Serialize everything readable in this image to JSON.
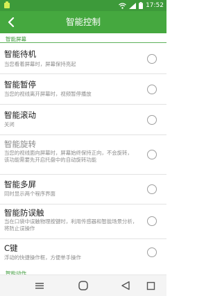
{
  "status_bar": {
    "time": "17:52",
    "icons": [
      "app-notification-icon",
      "wifi-icon",
      "signal-icon",
      "battery-icon"
    ]
  },
  "app_bar": {
    "title": "智能控制",
    "back_icon": "chevron-left-icon"
  },
  "section": {
    "header": "智能屏幕"
  },
  "items": [
    {
      "title": "智能待机",
      "description": "当您看着屏幕时，屏幕保持亮起",
      "enabled": true,
      "checked": false
    },
    {
      "title": "智能暂停",
      "description": "当您的视线离开屏幕时，视频暂停播放",
      "enabled": true,
      "checked": false
    },
    {
      "title": "智能滚动",
      "description": "关闭",
      "enabled": true,
      "checked": false
    },
    {
      "title": "智能旋转",
      "description": "当您的视线面向屏幕时，屏幕始终保持正向，不会旋转，该功能需要先开启托盘中的自动旋转功能",
      "enabled": false,
      "checked": false
    },
    {
      "title": "智能多屏",
      "description": "同时显示两个程序界面",
      "enabled": true,
      "checked": false
    },
    {
      "title": "智能防误触",
      "description": "当在口袋中误触物理按键时，利用传感器和智能场景分析，将防止误操作",
      "enabled": true,
      "checked": false
    },
    {
      "title": "C键",
      "description": "浮动的快捷操作框，方便单手操作",
      "enabled": true,
      "checked": false
    }
  ],
  "partial_section_header": "智能动作",
  "nav_bar": {
    "icons": [
      "menu-icon",
      "home-icon",
      "back-icon",
      "recents-icon"
    ]
  },
  "colors": {
    "status_bar": "#3d9a3a",
    "app_bar": "#45a83f",
    "accent": "#3d9a3a"
  }
}
